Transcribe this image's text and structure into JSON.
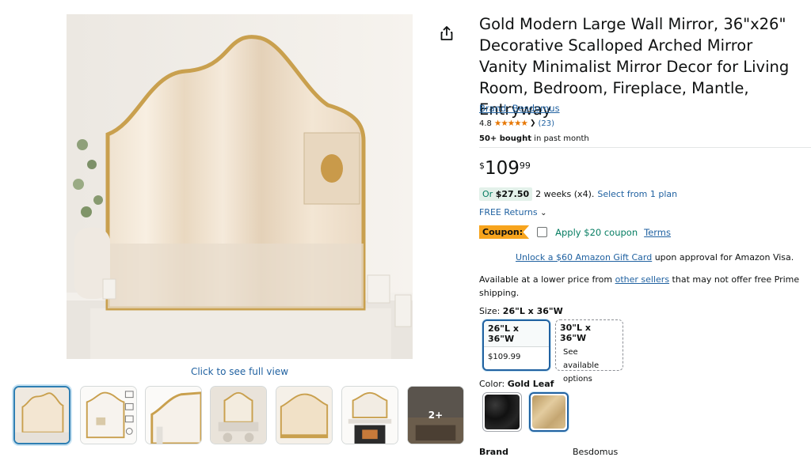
{
  "product": {
    "title": "Gold Modern Large Wall Mirror, 36\"x26\" Decorative Scalloped Arched Mirror Vanity Minimalist Mirror Decor for Living Room, Bedroom, Fireplace, Mantle, Entryway",
    "brand_link": "Brand: Besdomus",
    "rating": "4.8",
    "stars": "★★★★★",
    "rating_count": "(23)",
    "bought_bold": "50+ bought",
    "bought_rest": " in past month"
  },
  "gallery": {
    "full_view_link": "Click to see full view",
    "more_label": "2+"
  },
  "price": {
    "symbol": "$",
    "whole": "109",
    "fraction": "99"
  },
  "installment": {
    "prefix": "Or ",
    "amount": "$27.50",
    "detail": "2 weeks (x4).",
    "link": "Select from 1 plan"
  },
  "returns": {
    "label": "FREE Returns"
  },
  "coupon": {
    "badge": "Coupon:",
    "text": "Apply $20 coupon",
    "terms": "Terms"
  },
  "gift_card": {
    "link": "Unlock a $60 Amazon Gift Card",
    "rest": " upon approval for Amazon Visa."
  },
  "lower_price": {
    "before": "Available at a lower price from ",
    "link": "other sellers",
    "after": " that may not offer free Prime shipping."
  },
  "size": {
    "label": "Size: ",
    "selected": "26\"L x 36\"W",
    "options": [
      {
        "name": "26\"L x 36\"W",
        "sub": "$109.99"
      },
      {
        "name": "30\"L x 36\"W",
        "sub": "See available options"
      }
    ]
  },
  "color": {
    "label": "Color: ",
    "selected": "Gold Leaf",
    "swatch_colors": [
      "#1a1a1a",
      "#c9ae82"
    ]
  },
  "specs": {
    "brand_label": "Brand",
    "brand_value": "Besdomus"
  },
  "colors": {
    "link": "#2162a1",
    "deal_green": "#067d62",
    "coupon_orange": "#f7a41d",
    "star": "#e77600"
  }
}
